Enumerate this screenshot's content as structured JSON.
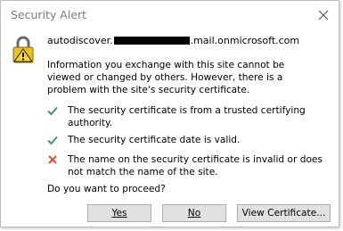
{
  "dialog": {
    "title": "Security Alert",
    "host_prefix": "autodiscover.",
    "host_suffix": ".mail.onmicrosoft.com",
    "info": "Information you exchange with this site cannot be viewed or changed by others. However, there is a problem with the site's security certificate.",
    "items": [
      {
        "status": "ok",
        "icon": "check-icon",
        "text": "The security certificate is from a trusted certifying authority."
      },
      {
        "status": "ok",
        "icon": "check-icon",
        "text": "The security certificate date is valid."
      },
      {
        "status": "error",
        "icon": "x-icon",
        "text": "The name on the security certificate is invalid or does not match the name of the site."
      }
    ],
    "question": "Do you want to proceed?",
    "buttons": {
      "yes": "Yes",
      "no": "No",
      "view": "View Certificate..."
    }
  },
  "colors": {
    "check": "#4a8f80",
    "error": "#d8502c",
    "title_text": "#7a7a7a",
    "button_bg": "#e1e1e1"
  }
}
